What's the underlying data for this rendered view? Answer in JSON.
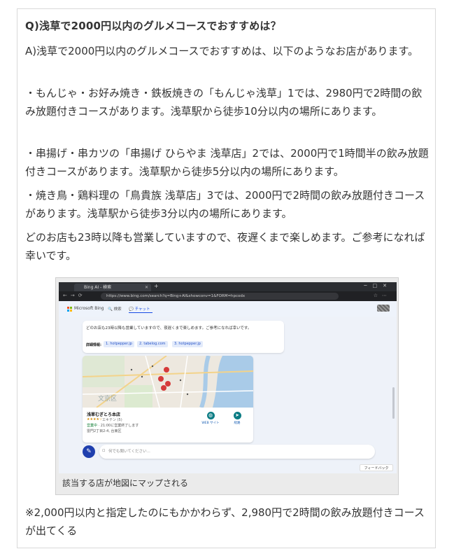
{
  "question": "Q)浅草で2000円以内のグルメコースでおすすめは？",
  "paragraphs": [
    "A)浅草で2000円以内のグルメコースでおすすめは、以下のようなお店があります。",
    "・もんじゃ・お好み焼き・鉄板焼きの「もんじゃ浅草」1では、2980円で2時間の飲み放題付きコースがあります。浅草駅から徒歩10分以内の場所にあります。",
    "・串揚げ・串カツの「串揚げ ひらやま 浅草店」2では、2000円で1時間半の飲み放題付きコースがあります。浅草駅から徒歩5分以内の場所にあります。",
    "・焼き鳥・鶏料理の「鳥貴族 浅草店」3では、2000円で2時間の飲み放題付きコースがあります。浅草駅から徒歩3分以内の場所にあります。",
    "どのお店も23時以降も営業していますので、夜遅くまで楽しめます。ご参考になれば幸いです。"
  ],
  "figure": {
    "caption": "該当する店が地図にマップされる",
    "browser": {
      "tab_title": "Bing AI - 検索",
      "url": "https://www.bing.com/search?q=Bing+AI&showconv=1&FORM=hpcodx"
    },
    "bing": {
      "logo_text": "Microsoft Bing",
      "nav_search": "検索",
      "nav_chat": "チャット",
      "answer_text": "どのお店も23時以降も営業していますので、夜遅くまで楽しめます。ご参考になれば幸いです。",
      "learn_more_label": "詳細情報:",
      "sources": [
        "1. hotpepper.jp",
        "2. tabelog.com",
        "3. hotpepper.jp"
      ],
      "map_label": "文京区",
      "store": {
        "name": "浅草むぎとろ本店",
        "stars": "★★★★☆",
        "rating_text": "エキテン (5)",
        "status": "営業中",
        "hours": " · 21:00に営業終了します",
        "address": "雷門2丁目2-4, 台東区"
      },
      "actions": [
        "WEB サイト",
        "経路"
      ],
      "chat_placeholder": "何でも聞いてください...",
      "feedback": "フィードバック"
    }
  },
  "note": "※2,000円以内と指定したのにもかかわらず、2,980円で2時間の飲み放題付きコースが出てくる"
}
